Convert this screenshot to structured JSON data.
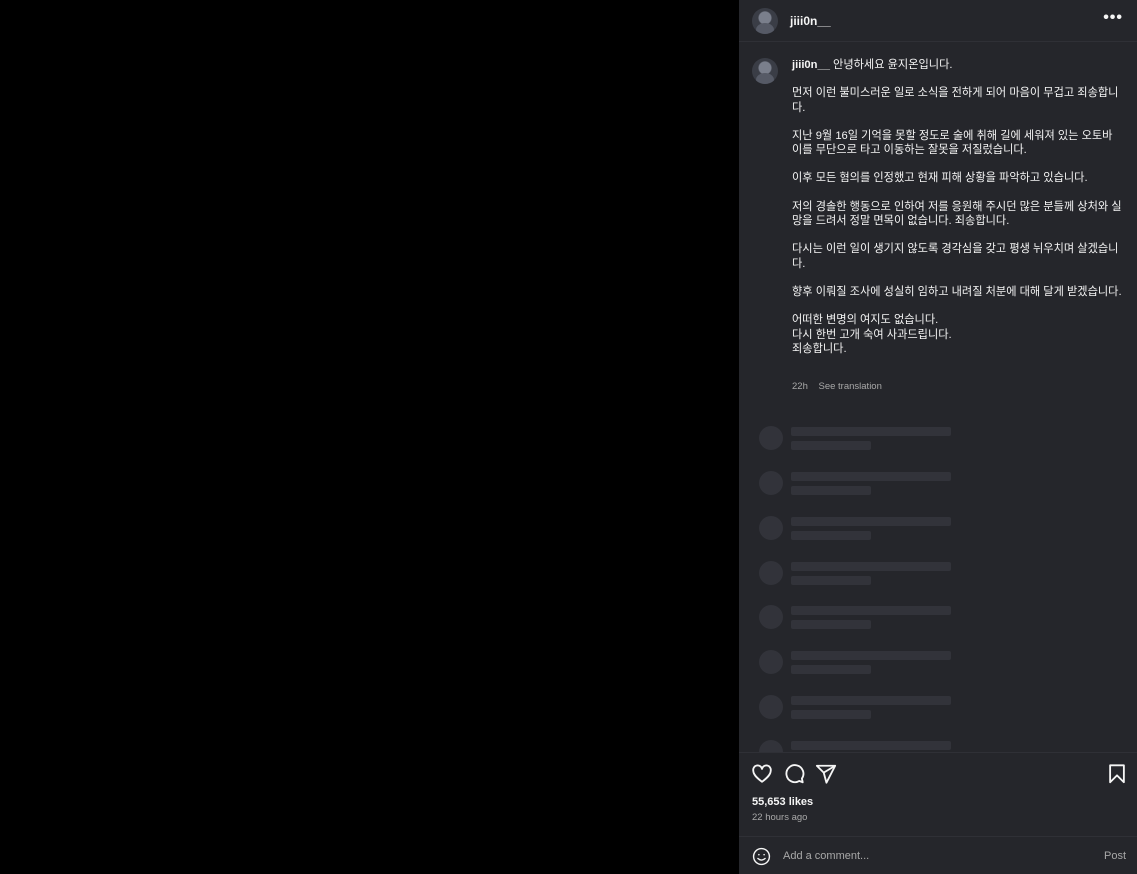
{
  "post": {
    "username": "jiii0n__",
    "more_icon": "more-horizontal-icon"
  },
  "caption": {
    "username": "jiii0n__",
    "greeting": "안녕하세요 윤지온입니다.",
    "paragraphs": [
      "먼저 이런 불미스러운 일로 소식을 전하게 되어 마음이 무겁고 죄송합니다.",
      "지난 9월 16일 기억을 못할 정도로 술에 취해 길에 세워져 있는 오토바이를 무단으로 타고 이동하는 잘못을 저질렀습니다.",
      "이후 모든 혐의를 인정했고 현재 피해 상황을 파악하고 있습니다.",
      "저의 경솔한 행동으로 인하여 저를 응원해 주시던 많은 분들께 상처와 실망을 드려서 정말 면목이 없습니다. 죄송합니다.",
      "다시는 이런 일이 생기지 않도록 경각심을 갖고 평생 뉘우치며 살겠습니다.",
      "향후 이뤄질 조사에 성실히 임하고 내려질 처분에 대해 달게 받겠습니다."
    ],
    "closing": [
      "어떠한 변명의 여지도 없습니다.",
      "다시 한번 고개 숙여 사과드립니다.",
      "죄송합니다."
    ],
    "age": "22h",
    "see_translation": "See translation"
  },
  "actions": {
    "like_icon": "heart-icon",
    "comment_icon": "comment-icon",
    "share_icon": "paper-plane-icon",
    "save_icon": "bookmark-icon"
  },
  "stats": {
    "likes": "55,653 likes",
    "time_ago": "22 hours ago"
  },
  "composer": {
    "emoji_icon": "smiley-icon",
    "placeholder": "Add a comment...",
    "post_label": "Post"
  },
  "colors": {
    "panel_bg": "#25262b",
    "media_bg": "#000000",
    "muted_text": "#a8a8a8",
    "primary_text": "#f5f5f5"
  }
}
